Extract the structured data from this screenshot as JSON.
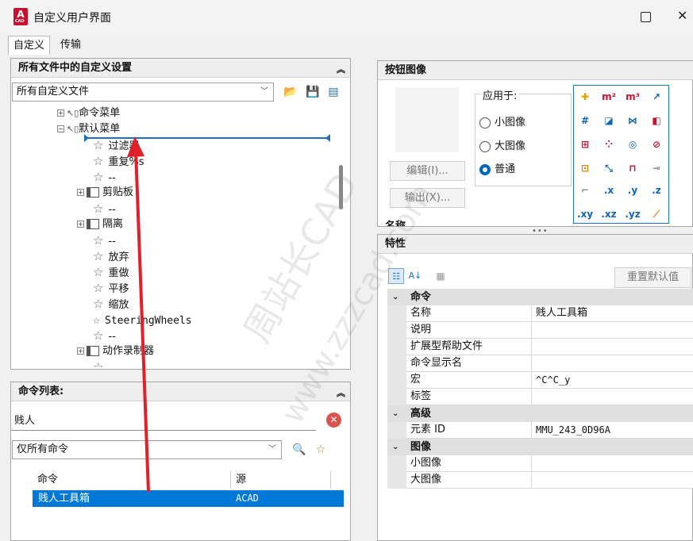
{
  "window": {
    "title": "自定义用户界面",
    "app_icon_letter": "A",
    "app_icon_sub": "CAD"
  },
  "tabs": [
    {
      "label": "自定义"
    },
    {
      "label": "传输"
    }
  ],
  "customizations_panel": {
    "title": "所有文件中的自定义设置",
    "file_combo": "所有自定义文件",
    "tree": [
      {
        "label": "命令菜单",
        "type": "menu",
        "expander": "+"
      },
      {
        "label": "默认菜单",
        "type": "menu",
        "expander": "-"
      },
      {
        "label": "过滤器",
        "type": "cmd"
      },
      {
        "label": "重复%s",
        "type": "cmd"
      },
      {
        "label": "--",
        "type": "cmd"
      },
      {
        "label": "剪贴板",
        "type": "sub",
        "expander": "+"
      },
      {
        "label": "--",
        "type": "cmd"
      },
      {
        "label": "隔离",
        "type": "sub",
        "expander": "+"
      },
      {
        "label": "--",
        "type": "cmd"
      },
      {
        "label": "放弃",
        "type": "cmd"
      },
      {
        "label": "重做",
        "type": "cmd"
      },
      {
        "label": "平移",
        "type": "cmd"
      },
      {
        "label": "缩放",
        "type": "cmd"
      },
      {
        "label": "SteeringWheels",
        "type": "cmd"
      },
      {
        "label": "--",
        "type": "cmd"
      },
      {
        "label": "动作录制器",
        "type": "sub",
        "expander": "+"
      },
      {
        "label": "--",
        "type": "cmd"
      }
    ]
  },
  "command_list": {
    "title": "命令列表:",
    "search_value": "贱人",
    "filter_combo": "仅所有命令",
    "columns": [
      "命令",
      "源"
    ],
    "rows": [
      {
        "command": "贱人工具箱",
        "source": "ACAD"
      }
    ]
  },
  "button_image": {
    "title": "按钮图像",
    "apply_to_label": "应用于:",
    "options": [
      "小图像",
      "大图像",
      "普通"
    ],
    "selected": "普通",
    "edit_button": "编辑(I)...",
    "export_button": "输出(X)...",
    "name_partial": "名称",
    "grid_icons": [
      "plus-icon",
      "m2-icon",
      "m3-icon",
      "arc-icon",
      "grid-icon",
      "crop-icon",
      "mirror-icon",
      "mvsetup-icon",
      "frame-icon",
      "dots-icon",
      "target-icon",
      "circle-icon",
      "color-icon",
      "ruler-icon",
      "box-icon",
      "link-icon",
      "line-icon",
      ".x",
      ".y",
      ".z",
      "blank",
      ".xy",
      ".xz",
      ".yz",
      "slope-icon"
    ]
  },
  "properties": {
    "title": "特性",
    "reset_button": "重置默认值",
    "categories": [
      {
        "name": "命令",
        "rows": [
          {
            "key": "名称",
            "value": "贱人工具箱"
          },
          {
            "key": "说明",
            "value": ""
          },
          {
            "key": "扩展型帮助文件",
            "value": ""
          },
          {
            "key": "命令显示名",
            "value": ""
          },
          {
            "key": "宏",
            "value": "^C^C_y"
          },
          {
            "key": "标签",
            "value": ""
          }
        ]
      },
      {
        "name": "高级",
        "rows": [
          {
            "key": "元素 ID",
            "value": "MMU_243_0D96A"
          }
        ]
      },
      {
        "name": "图像",
        "rows": [
          {
            "key": "小图像",
            "value": ""
          },
          {
            "key": "大图像",
            "value": ""
          }
        ]
      }
    ]
  },
  "watermark": {
    "line1": "周站长CAD",
    "line2": "www.zzzcad.com"
  },
  "colors": {
    "selection": "#0078d7",
    "arrow": "#e2202b",
    "drop_line": "#1f6fbf"
  }
}
